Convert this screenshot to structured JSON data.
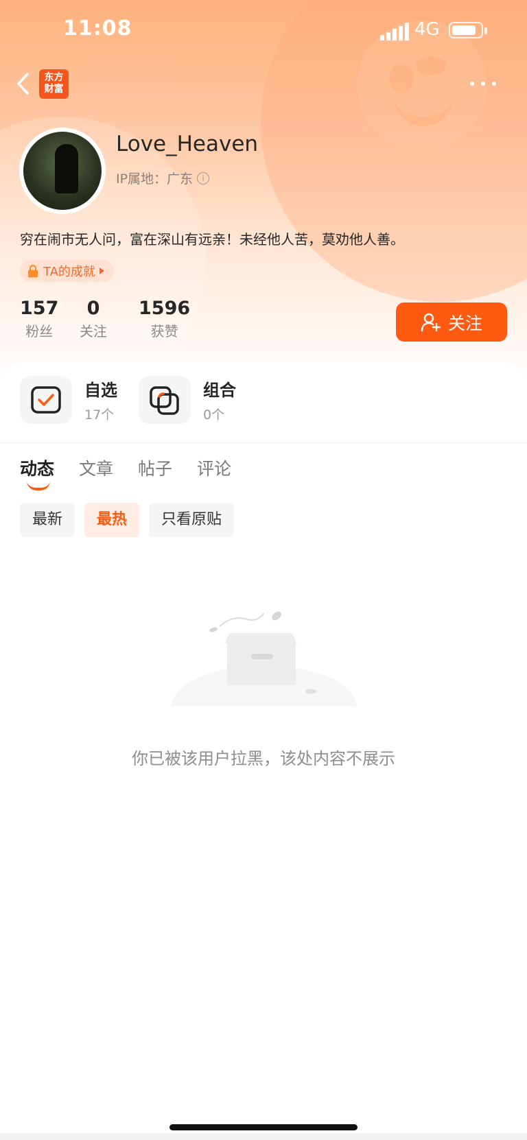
{
  "status_bar": {
    "time": "11:08",
    "network": "4G",
    "battery_level": 0.8
  },
  "header": {
    "logo_line1": "东方",
    "logo_line2": "财富"
  },
  "profile": {
    "username": "Love_Heaven",
    "ip_label": "IP属地：广东",
    "bio": "穷在闹市无人问，富在深山有远亲！未经他人苦，莫劝他人善。",
    "achievement_label": "TA的成就"
  },
  "stats": [
    {
      "value": "157",
      "label": "粉丝"
    },
    {
      "value": "0",
      "label": "关注"
    },
    {
      "value": "1596",
      "label": "获赞"
    }
  ],
  "follow_button": {
    "label": "关注"
  },
  "features": [
    {
      "title": "自选",
      "sub": "17个"
    },
    {
      "title": "组合",
      "sub": "0个"
    }
  ],
  "tabs": [
    "动态",
    "文章",
    "帖子",
    "评论"
  ],
  "active_tab": "动态",
  "filters": [
    "最新",
    "最热",
    "只看原贴"
  ],
  "active_filter": "最热",
  "empty_message": "你已被该用户拉黑，该处内容不展示",
  "colors": {
    "accent": "#ff5a12",
    "header_gradient_top": "#ffb17d"
  }
}
